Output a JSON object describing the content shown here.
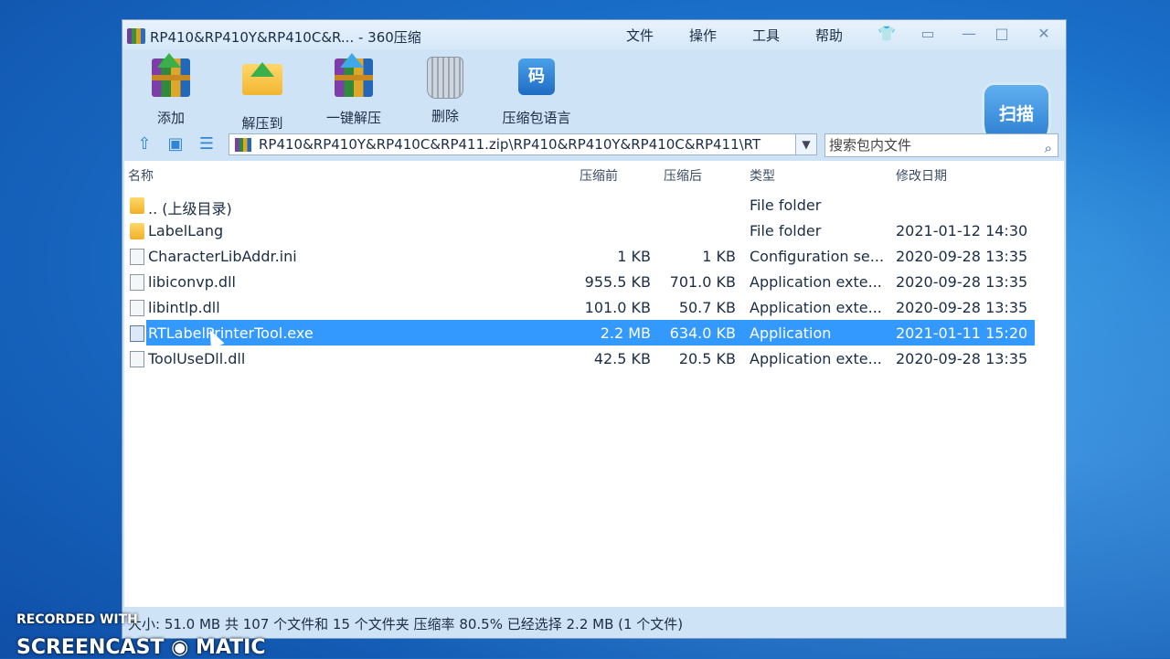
{
  "window": {
    "title": "RP410&RP410Y&RP410C&R... - 360压缩",
    "menu": [
      "文件",
      "操作",
      "工具",
      "帮助"
    ],
    "title_icons": [
      "shirt-icon",
      "feedback-icon",
      "minimize-icon",
      "maximize-icon",
      "close-icon"
    ]
  },
  "toolbar": {
    "add_label": "添加",
    "extract_to_label": "解压到",
    "one_click_extract_label": "一键解压",
    "delete_label": "删除",
    "compress_lang_label": "压缩包语言",
    "scan_label": "扫描"
  },
  "nav": {
    "path": "RP410&RP410Y&RP410C&RP411.zip\\RP410&RP410Y&RP410C&RP411\\RT",
    "search_placeholder": "搜索包内文件"
  },
  "columns": {
    "name": "名称",
    "size_before": "压缩前",
    "size_after": "压缩后",
    "type": "类型",
    "modified": "修改日期"
  },
  "files": [
    {
      "name": ".. (上级目录)",
      "before": "",
      "after": "",
      "type": "File folder",
      "date": "",
      "kind": "folder"
    },
    {
      "name": "LabelLang",
      "before": "",
      "after": "",
      "type": "File folder",
      "date": "2021-01-12 14:30",
      "kind": "folder"
    },
    {
      "name": "CharacterLibAddr.ini",
      "before": "1 KB",
      "after": "1 KB",
      "type": "Configuration se...",
      "date": "2020-09-28 13:35",
      "kind": "file"
    },
    {
      "name": "libiconvp.dll",
      "before": "955.5 KB",
      "after": "701.0 KB",
      "type": "Application exte...",
      "date": "2020-09-28 13:35",
      "kind": "file"
    },
    {
      "name": "libintlp.dll",
      "before": "101.0 KB",
      "after": "50.7 KB",
      "type": "Application exte...",
      "date": "2020-09-28 13:35",
      "kind": "file"
    },
    {
      "name": "RTLabelPrinterTool.exe",
      "before": "2.2 MB",
      "after": "634.0 KB",
      "type": "Application",
      "date": "2021-01-11 15:20",
      "kind": "exe"
    },
    {
      "name": "ToolUseDll.dll",
      "before": "42.5 KB",
      "after": "20.5 KB",
      "type": "Application exte...",
      "date": "2020-09-28 13:35",
      "kind": "file"
    }
  ],
  "selected_index": 5,
  "status": "大小: 51.0 MB 共 107 个文件和 15 个文件夹 压缩率 80.5% 已经选择 2.2 MB (1 个文件)",
  "watermark": {
    "top": "RECORDED WITH",
    "bottom": "SCREENCAST ◉ MATIC"
  },
  "colors": {
    "selection": "#3399ff",
    "window_bg": "#cfe3f6",
    "desktop": "#1a6fc8"
  }
}
